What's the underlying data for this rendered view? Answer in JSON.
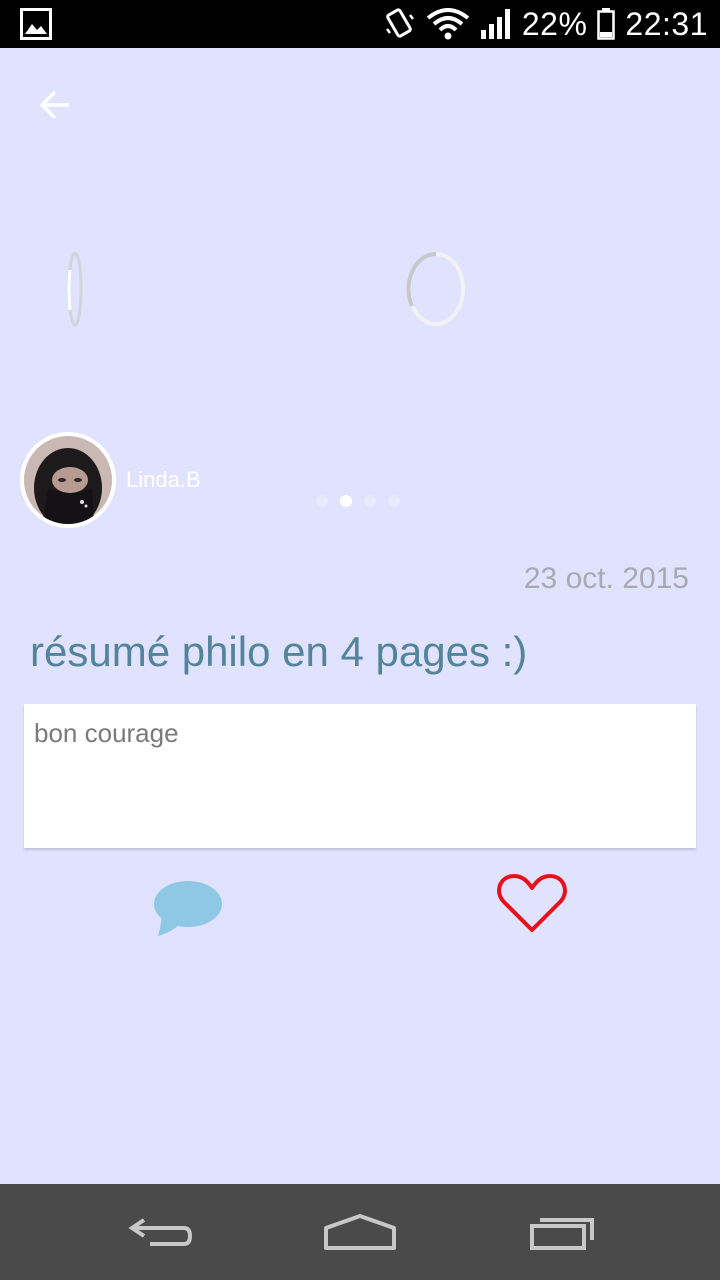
{
  "status_bar": {
    "battery_percent": "22%",
    "time": "22:31",
    "icons": [
      "gallery-icon",
      "vibrate-icon",
      "wifi-icon",
      "signal-icon",
      "battery-icon"
    ]
  },
  "header": {
    "back_icon": "arrow-left-icon"
  },
  "post": {
    "author": "Linda.B",
    "date": "23 oct. 2015",
    "title": "résumé philo en 4 pages :)",
    "comment": "bon courage",
    "carousel": {
      "pages": 4,
      "active_index": 1
    },
    "actions": {
      "comment_icon": "speech-bubble-icon",
      "like_icon": "heart-icon"
    }
  },
  "colors": {
    "background": "#e1e2fd",
    "title": "#54849c",
    "date": "#a9a9b3",
    "comment_icon": "#8fc8e4",
    "like_icon": "#e8101a",
    "nav_bar": "#4a4a4a"
  },
  "nav_bar": {
    "icons": [
      "back-icon",
      "home-icon",
      "recent-apps-icon"
    ]
  }
}
